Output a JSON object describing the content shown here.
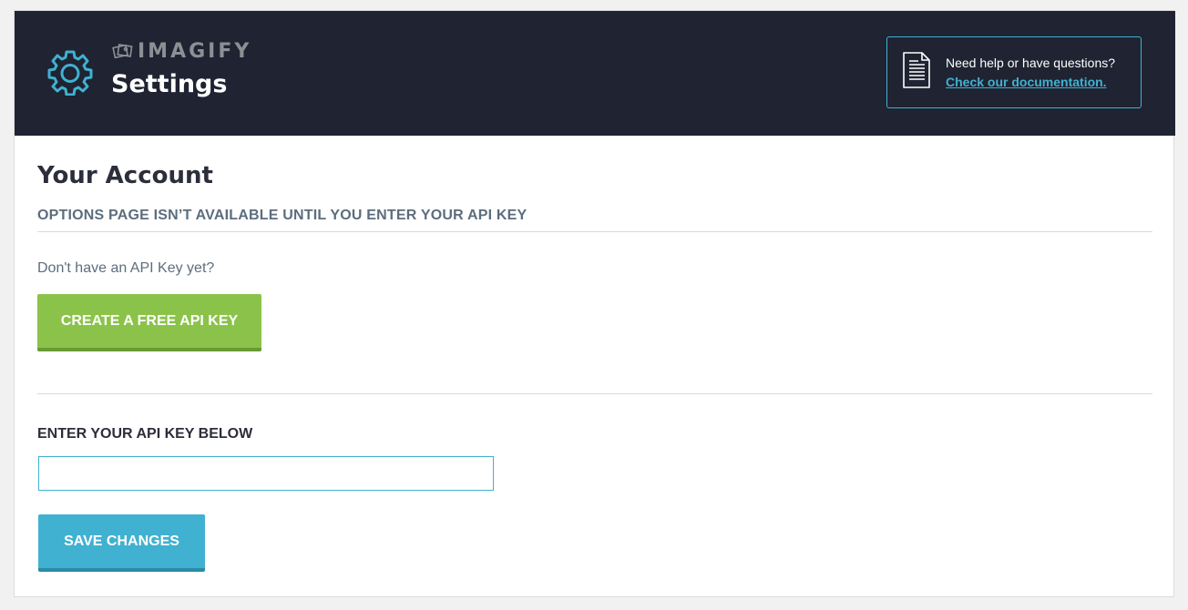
{
  "header": {
    "brand": "IMAGIFY",
    "title": "Settings",
    "help_text": "Need help or have questions?",
    "help_link": "Check our documentation."
  },
  "account": {
    "title": "Your Account",
    "subtitle": "OPTIONS PAGE ISN’T AVAILABLE UNTIL YOU ENTER YOUR API KEY",
    "no_key_text": "Don't have an API Key yet?",
    "create_button": "CREATE A FREE API KEY"
  },
  "api_key": {
    "label": "ENTER YOUR API KEY BELOW",
    "value": "",
    "save_button": "SAVE CHANGES"
  },
  "icons": {
    "settings": "gear-icon",
    "brand": "imagify-logo-icon",
    "help": "document-icon"
  },
  "colors": {
    "header_bg": "#1f2332",
    "accent_blue": "#40b1d0",
    "accent_green": "#8bc34a",
    "brand_gray": "#8c8f94"
  }
}
